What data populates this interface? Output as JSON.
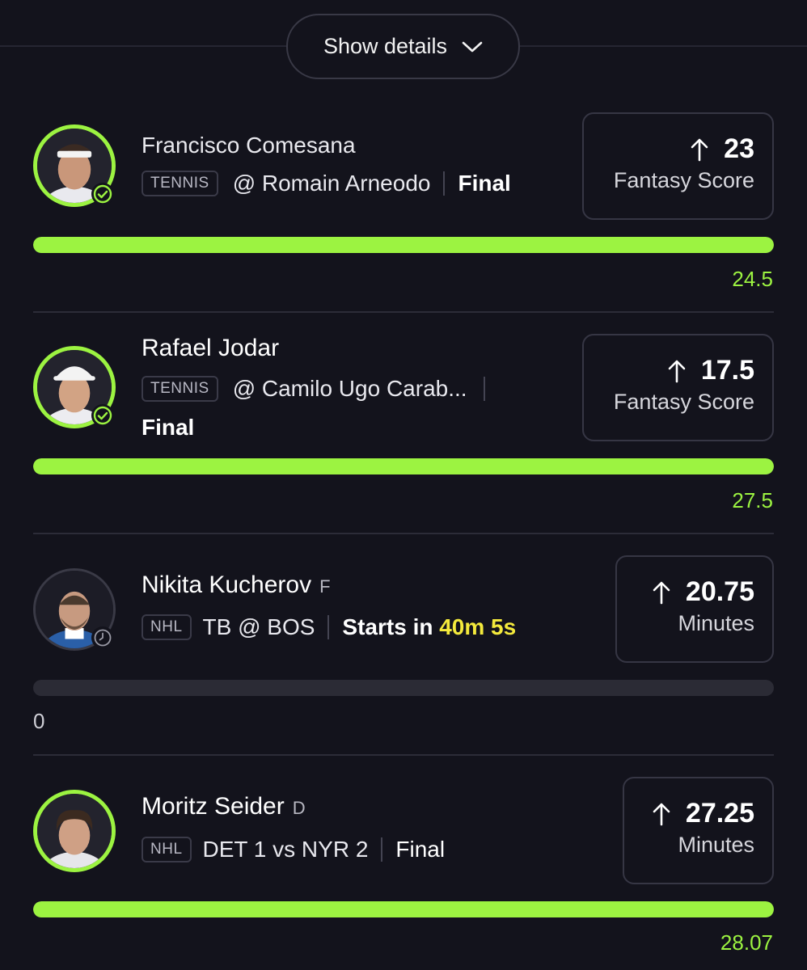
{
  "header": {
    "show_details_label": "Show details"
  },
  "colors": {
    "accent_green": "#9cf341",
    "countdown_yellow": "#f4ea3c",
    "background": "#13131c"
  },
  "picks": [
    {
      "player": "Francisco Comesana",
      "position": "",
      "sport": "TENNIS",
      "matchup": "@ Romain Arneodo",
      "status": "Final",
      "direction_icon": "arrow-up-icon",
      "line": "23",
      "stat": "Fantasy Score",
      "progress": 1.0,
      "actual": "24.5",
      "avatar_status_icon": "check-circle-icon"
    },
    {
      "player": "Rafael Jodar",
      "position": "",
      "sport": "TENNIS",
      "matchup": "@ Camilo Ugo Carab...",
      "status": "Final",
      "direction_icon": "arrow-up-icon",
      "line": "17.5",
      "stat": "Fantasy Score",
      "progress": 1.0,
      "actual": "27.5",
      "avatar_status_icon": "check-circle-icon"
    },
    {
      "player": "Nikita Kucherov",
      "position": "F",
      "sport": "NHL",
      "matchup": "TB @ BOS",
      "status_prefix": "Starts in ",
      "countdown": "40m 5s",
      "direction_icon": "arrow-up-icon",
      "line": "20.75",
      "stat": "Minutes",
      "progress": 0.0,
      "actual": "0",
      "avatar_status_icon": "clock-icon"
    },
    {
      "player": "Moritz Seider",
      "position": "D",
      "sport": "NHL",
      "matchup": "DET 1 vs NYR 2",
      "status": "Final",
      "direction_icon": "arrow-up-icon",
      "line": "27.25",
      "stat": "Minutes",
      "progress": 1.0,
      "actual": "28.07",
      "avatar_status_icon": "check-circle-icon"
    }
  ]
}
